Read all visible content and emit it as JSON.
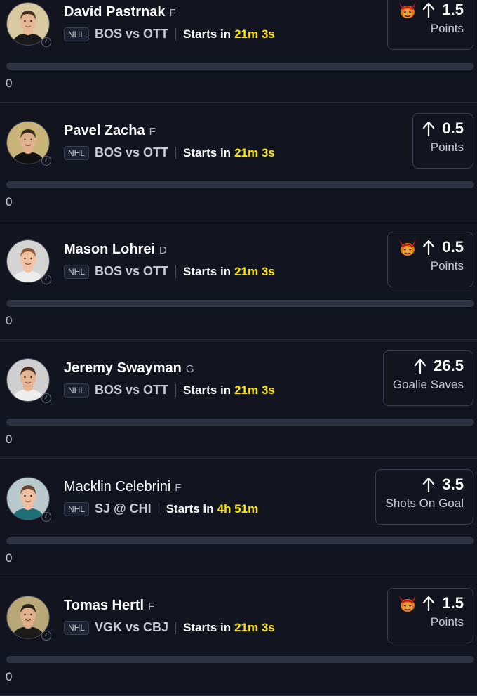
{
  "colors": {
    "background": "#121420",
    "accent_timer": "#ffe600",
    "divider": "#2a2d3d",
    "progress_track": "#2f3242"
  },
  "icons": {
    "promo": "devil-icon",
    "direction": "arrow-up-icon",
    "status": "clock-icon"
  },
  "cards": [
    {
      "name": "David Pastrnak",
      "position": "F",
      "league": "NHL",
      "matchup": "BOS vs OTT",
      "starts_label": "Starts in",
      "timer": "21m 3s",
      "promo": true,
      "line": "1.5",
      "stat": "Points",
      "progress": 0,
      "progress_label": "0",
      "skin": "#e8b896",
      "hair": "#4a3322",
      "shirt": "#1a1a1a",
      "bg": "#d8c9a0"
    },
    {
      "name": "Pavel Zacha",
      "position": "F",
      "league": "NHL",
      "matchup": "BOS vs OTT",
      "starts_label": "Starts in",
      "timer": "21m 3s",
      "promo": false,
      "line": "0.5",
      "stat": "Points",
      "progress": 0,
      "progress_label": "0",
      "skin": "#e0b08c",
      "hair": "#3a2a1c",
      "shirt": "#111111",
      "bg": "#c8b478"
    },
    {
      "name": "Mason Lohrei",
      "position": "D",
      "league": "NHL",
      "matchup": "BOS vs OTT",
      "starts_label": "Starts in",
      "timer": "21m 3s",
      "promo": true,
      "line": "0.5",
      "stat": "Points",
      "progress": 0,
      "progress_label": "0",
      "skin": "#f0c2a2",
      "hair": "#8a5a36",
      "shirt": "#ececec",
      "bg": "#d4d4d4"
    },
    {
      "name": "Jeremy Swayman",
      "position": "G",
      "league": "NHL",
      "matchup": "BOS vs OTT",
      "starts_label": "Starts in",
      "timer": "21m 3s",
      "promo": false,
      "line": "26.5",
      "stat": "Goalie Saves",
      "progress": 0,
      "progress_label": "0",
      "skin": "#e4b493",
      "hair": "#4a3020",
      "shirt": "#ededed",
      "bg": "#cfcfcf"
    },
    {
      "name": "Macklin Celebrini",
      "position": "F",
      "league": "NHL",
      "matchup": "SJ @ CHI",
      "starts_label": "Starts in",
      "timer": "4h 51m",
      "promo": false,
      "line": "3.5",
      "stat": "Shots On Goal",
      "progress": 0,
      "progress_label": "0",
      "light_name": true,
      "skin": "#eec0a0",
      "hair": "#6a4830",
      "shirt": "#1f6e74",
      "bg": "#b9c9cc"
    },
    {
      "name": "Tomas Hertl",
      "position": "F",
      "league": "NHL",
      "matchup": "VGK vs CBJ",
      "starts_label": "Starts in",
      "timer": "21m 3s",
      "promo": true,
      "line": "1.5",
      "stat": "Points",
      "progress": 0,
      "progress_label": "0",
      "skin": "#dfae8a",
      "hair": "#2a2018",
      "shirt": "#1c1c1c",
      "bg": "#b8a878"
    }
  ]
}
